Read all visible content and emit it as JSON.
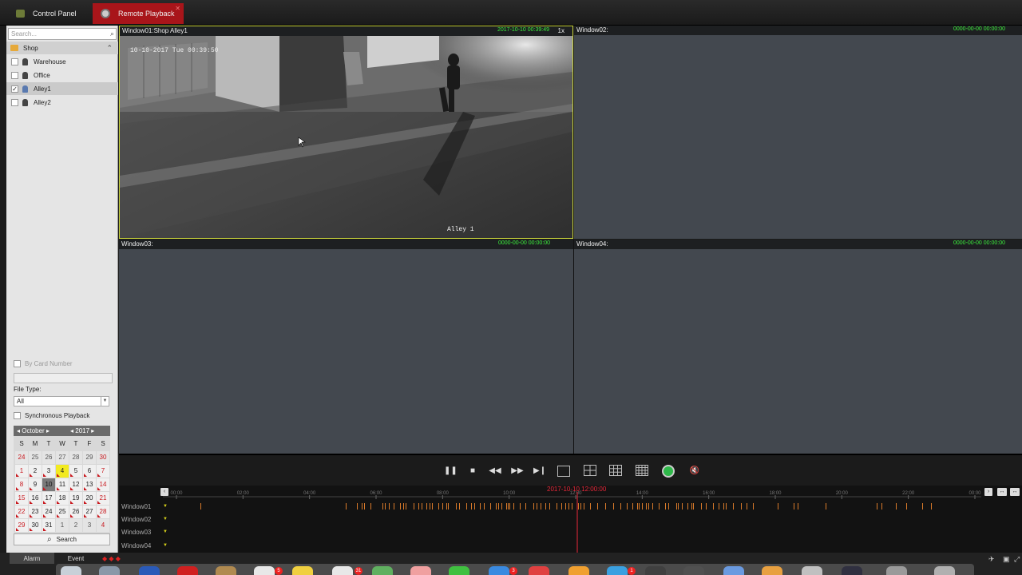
{
  "tabs": {
    "control_panel": "Control Panel",
    "remote_playback": "Remote Playback"
  },
  "sidebar": {
    "search_placeholder": "Search...",
    "group": "Shop",
    "cameras": [
      {
        "label": "Warehouse",
        "checked": false
      },
      {
        "label": "Office",
        "checked": false
      },
      {
        "label": "Alley1",
        "checked": true
      },
      {
        "label": "Alley2",
        "checked": false
      }
    ],
    "by_card_number": "By Card Number",
    "file_type_label": "File Type:",
    "file_type_value": "All",
    "sync_playback": "Synchronous Playback",
    "search_button": "Search"
  },
  "calendar": {
    "month": "October",
    "year": "2017",
    "weekdays": [
      "S",
      "M",
      "T",
      "W",
      "T",
      "F",
      "S"
    ],
    "days": [
      "24",
      "25",
      "26",
      "27",
      "28",
      "29",
      "30",
      "1",
      "2",
      "3",
      "4",
      "5",
      "6",
      "7",
      "8",
      "9",
      "10",
      "11",
      "12",
      "13",
      "14",
      "15",
      "16",
      "17",
      "18",
      "19",
      "20",
      "21",
      "22",
      "23",
      "24",
      "25",
      "26",
      "27",
      "28",
      "29",
      "30",
      "31",
      "1",
      "2",
      "3",
      "4"
    ],
    "today": "4",
    "selected": "10"
  },
  "windows": [
    {
      "title": "Window01:Shop Alley1",
      "time": "2017-10-10 00:39:49",
      "speed": "1x"
    },
    {
      "title": "Window02:",
      "time": "0000-00-00 00:00:00"
    },
    {
      "title": "Window03:",
      "time": "0000-00-00 00:00:00"
    },
    {
      "title": "Window04:",
      "time": "0000-00-00 00:00:00"
    }
  ],
  "video_overlay": {
    "timestamp": "10-10-2017 Tue 00:39:50",
    "camera_label": "Alley 1"
  },
  "timeline": {
    "center_time": "2017-10-10 12:00:00",
    "hours": [
      "00:00",
      "02:00",
      "04:00",
      "06:00",
      "08:00",
      "10:00",
      "12:00",
      "14:00",
      "16:00",
      "18:00",
      "20:00",
      "22:00",
      "00:00"
    ],
    "rows": [
      "Window01",
      "Window02",
      "Window03",
      "Window04"
    ]
  },
  "bottom_tabs": {
    "alarm": "Alarm",
    "event": "Event"
  },
  "dock_badges": [
    "5",
    "31",
    "3",
    "1"
  ],
  "colors": {
    "accent_red": "#a8151a",
    "time_green": "#3cf03c",
    "record_orange": "#d97a2a",
    "selection_yellow": "#c8d23a"
  }
}
